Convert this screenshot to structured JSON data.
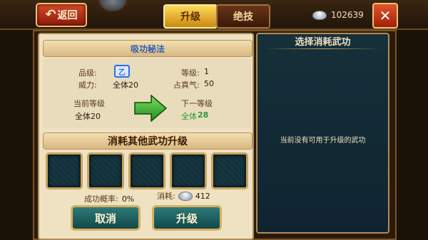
{
  "header": {
    "back_label": "返回",
    "tabs": [
      {
        "label": "升级",
        "active": true
      },
      {
        "label": "绝技",
        "active": false
      }
    ],
    "currency_value": "102639",
    "close_label": "✕"
  },
  "left": {
    "skill_name": "吸功秘法",
    "quality_label": "品级:",
    "quality_badge": "乙",
    "power_label": "威力:",
    "power_value": "全体20",
    "level_label": "等级:",
    "level_value": "1",
    "qi_label": "占真气:",
    "qi_value": "50",
    "current_level_label": "当前等级",
    "current_level_value": "全体20",
    "next_level_label": "下一等级",
    "next_level_prefix": "全体",
    "next_level_value": "28",
    "consume_title": "消耗其他武功升级",
    "success_label": "成功概率:",
    "success_value": "0%",
    "cost_label": "消耗:",
    "cost_value": "412",
    "cancel_label": "取消",
    "confirm_label": "升级"
  },
  "right": {
    "title": "选择消耗武功",
    "empty_message": "当前没有可用于升级的武功"
  },
  "colors": {
    "accent_gold": "#ffd85a",
    "panel_teal": "#16303a",
    "next_level_green": "#2e9a3a"
  }
}
